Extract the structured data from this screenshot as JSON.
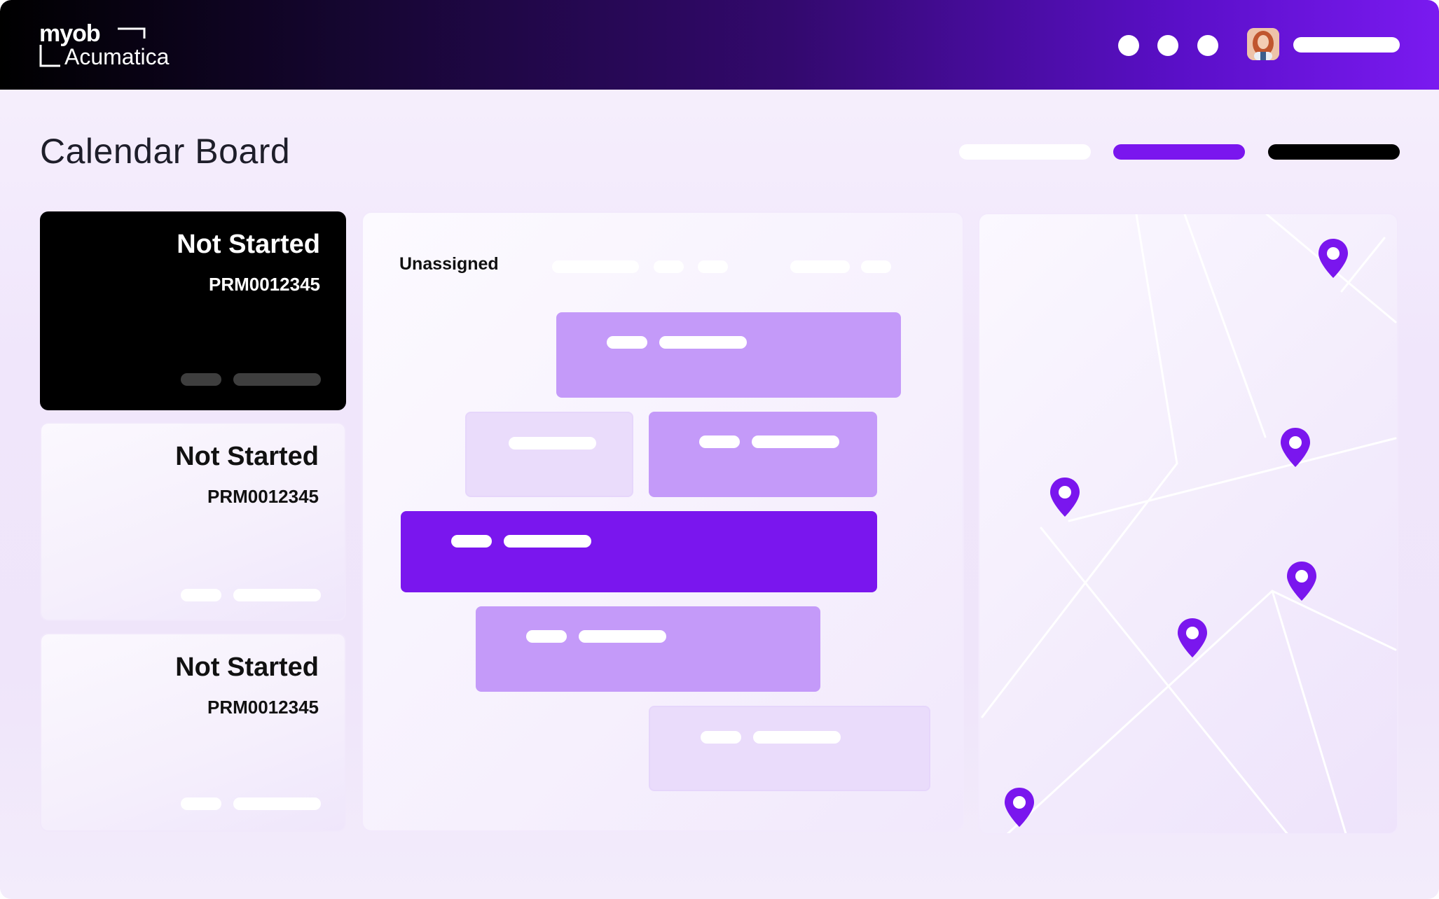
{
  "brand": {
    "logo_top": "myob",
    "logo_bottom": "Acumatica"
  },
  "header": {
    "page_title": "Calendar Board"
  },
  "cards": [
    {
      "status": "Not Started",
      "id": "PRM0012345",
      "style": "dark"
    },
    {
      "status": "Not Started",
      "id": "PRM0012345",
      "style": "light"
    },
    {
      "status": "Not Started",
      "id": "PRM0012345",
      "style": "light"
    }
  ],
  "schedule": {
    "column_label": "Unassigned"
  },
  "colors": {
    "accent": "#7a16ee",
    "block_light": "#c49af9",
    "block_pale": "#eadcfb",
    "header_dark": "#000000"
  },
  "icons": {
    "map_pin": "map-pin-icon",
    "more_dots": "more-dots-icon"
  }
}
